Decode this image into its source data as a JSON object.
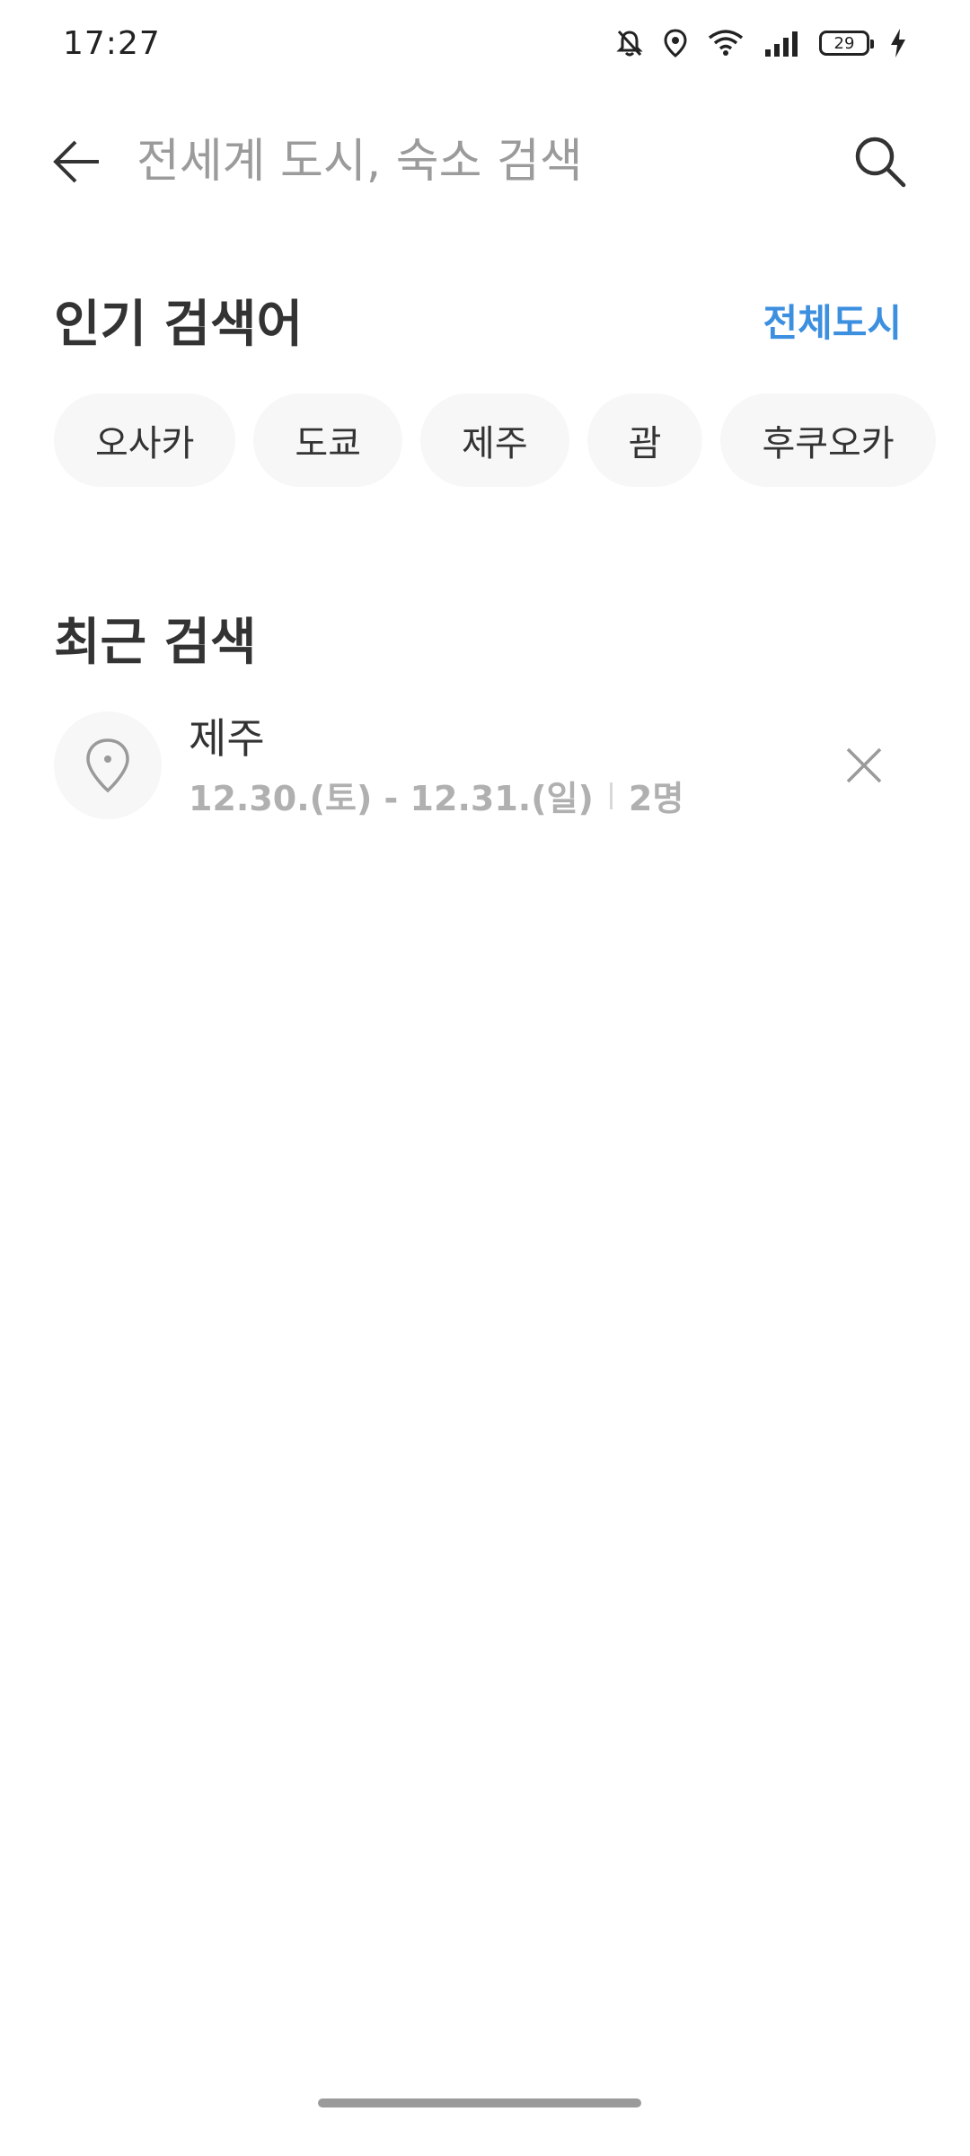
{
  "status_bar": {
    "time": "17:27",
    "battery": "29",
    "icons": [
      "bell-off-icon",
      "location-icon",
      "wifi-icon",
      "signal-icon",
      "battery-icon",
      "charging-icon"
    ]
  },
  "search": {
    "placeholder": "전세계 도시, 숙소 검색",
    "value": ""
  },
  "popular": {
    "title": "인기 검색어",
    "all_link": "전체도시",
    "chips": [
      "오사카",
      "도쿄",
      "제주",
      "괌",
      "후쿠오카"
    ]
  },
  "recent": {
    "title": "최근 검색",
    "items": [
      {
        "name": "제주",
        "dates": "12.30.(토) - 12.31.(일)",
        "guests": "2명"
      }
    ]
  },
  "colors": {
    "accent": "#3d8fe0",
    "text": "#333333",
    "muted": "#b0b0b0",
    "chip_bg": "#f7f7f7"
  }
}
